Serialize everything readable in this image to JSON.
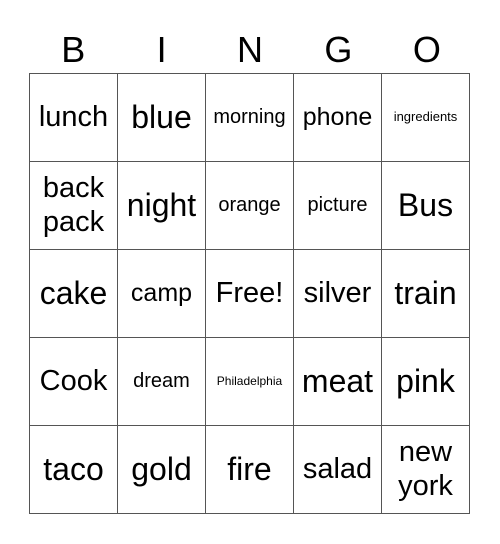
{
  "header": [
    "B",
    "I",
    "N",
    "G",
    "O"
  ],
  "cells": [
    {
      "text": "lunch",
      "size": "s-l"
    },
    {
      "text": "blue",
      "size": "s-xl"
    },
    {
      "text": "morning",
      "size": "s-s"
    },
    {
      "text": "phone",
      "size": "s-m"
    },
    {
      "text": "ingredients",
      "size": "s-xs"
    },
    {
      "text": "back pack",
      "size": "s-l"
    },
    {
      "text": "night",
      "size": "s-xl"
    },
    {
      "text": "orange",
      "size": "s-s"
    },
    {
      "text": "picture",
      "size": "s-s"
    },
    {
      "text": "Bus",
      "size": "s-xl"
    },
    {
      "text": "cake",
      "size": "s-xl"
    },
    {
      "text": "camp",
      "size": "s-m"
    },
    {
      "text": "Free!",
      "size": "s-l"
    },
    {
      "text": "silver",
      "size": "s-l"
    },
    {
      "text": "train",
      "size": "s-xl"
    },
    {
      "text": "Cook",
      "size": "s-l"
    },
    {
      "text": "dream",
      "size": "s-s"
    },
    {
      "text": "Philadelphia",
      "size": "s-xxs"
    },
    {
      "text": "meat",
      "size": "s-xl"
    },
    {
      "text": "pink",
      "size": "s-xl"
    },
    {
      "text": "taco",
      "size": "s-xl"
    },
    {
      "text": "gold",
      "size": "s-xl"
    },
    {
      "text": "fire",
      "size": "s-xl"
    },
    {
      "text": "salad",
      "size": "s-l"
    },
    {
      "text": "new york",
      "size": "s-l"
    }
  ]
}
